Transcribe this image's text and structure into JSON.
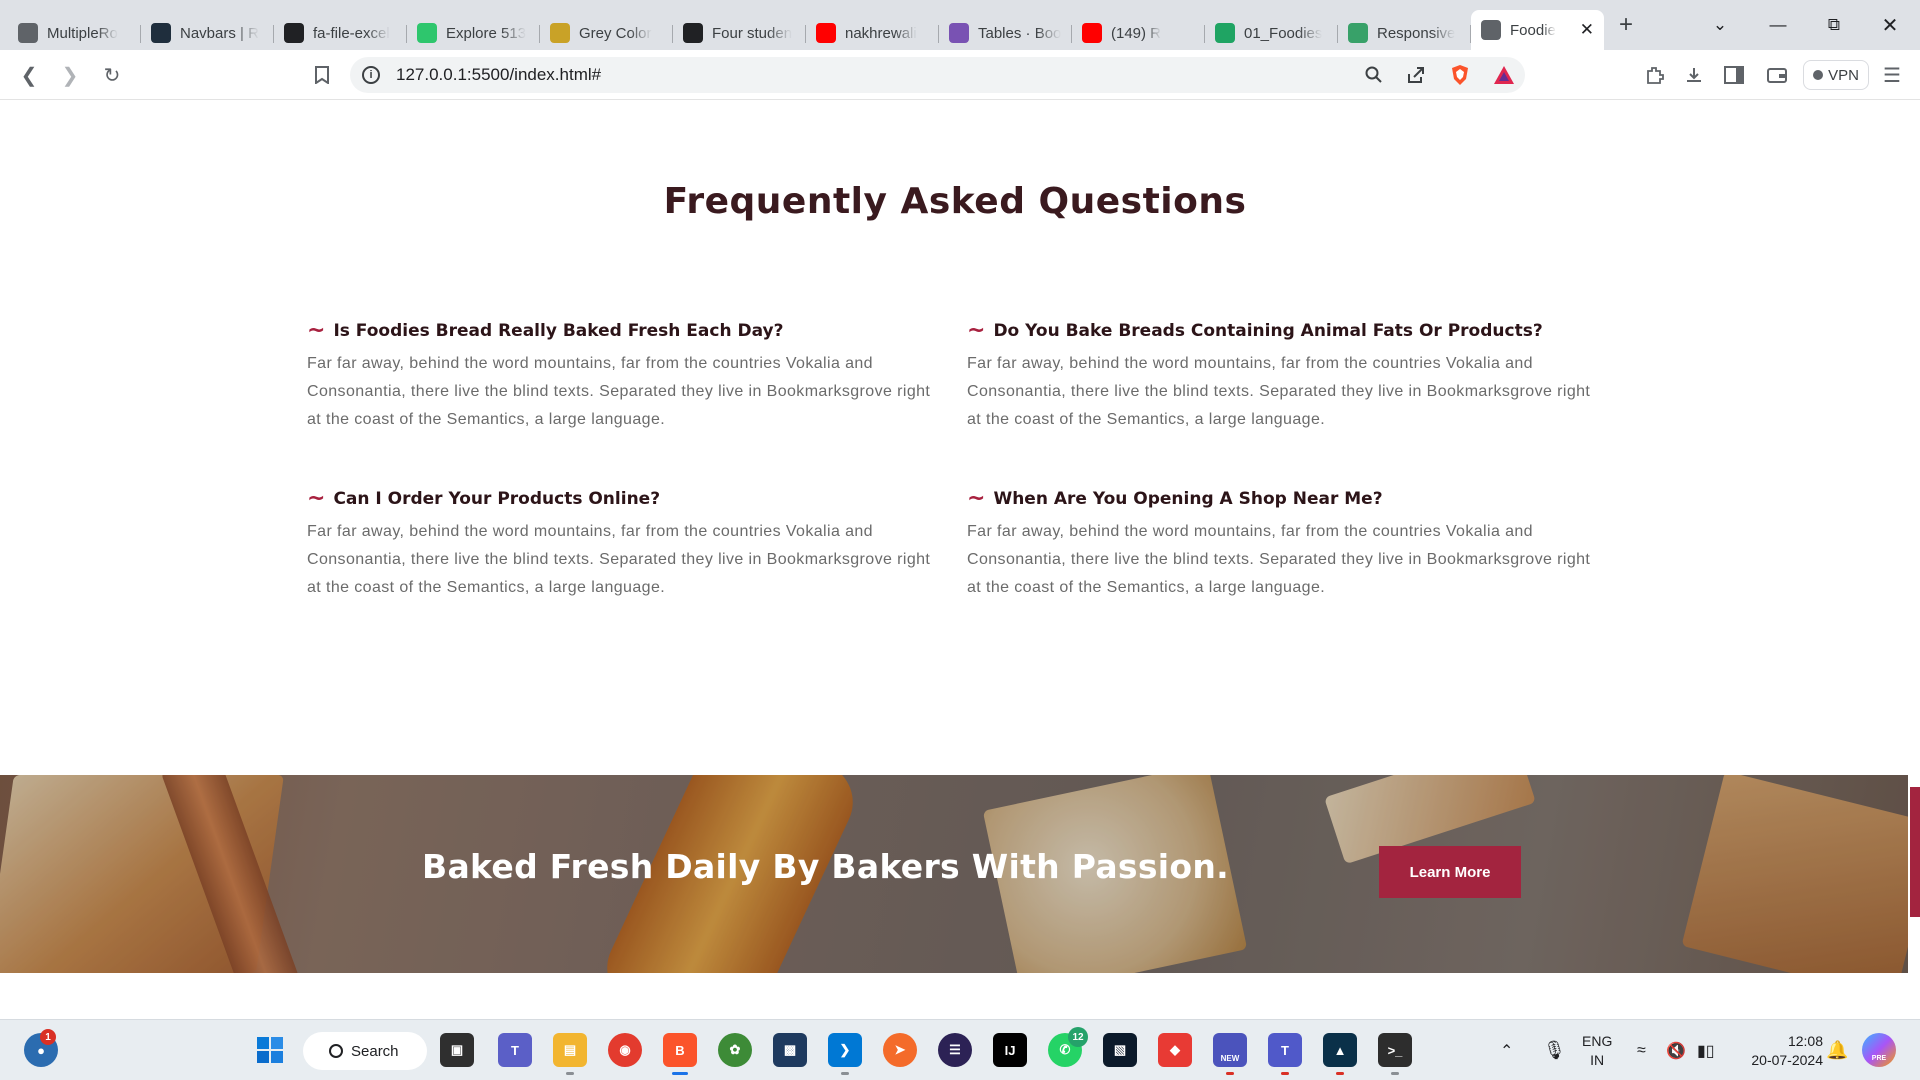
{
  "browser": {
    "tabs": [
      {
        "label": "MultipleRo",
        "icon": "globe-icon",
        "color": "#5f6368"
      },
      {
        "label": "Navbars | R",
        "icon": "react-bootstrap-icon",
        "color": "#1f2e3d"
      },
      {
        "label": "fa-file-excel",
        "icon": "font-awesome-flag-icon",
        "color": "#202124"
      },
      {
        "label": "Explore 513",
        "icon": "pixabay-icon",
        "color": "#2ec66d"
      },
      {
        "label": "Grey Color",
        "icon": "shield-icon",
        "color": "#c9a227"
      },
      {
        "label": "Four studen",
        "icon": "dev-icon",
        "color": "#202124"
      },
      {
        "label": "nakhrewali",
        "icon": "youtube-icon",
        "color": "#ff0000"
      },
      {
        "label": "Tables · Boo",
        "icon": "bootstrap-icon",
        "color": "#7952b3"
      },
      {
        "label": "(149) R",
        "icon": "youtube-muted-icon",
        "color": "#ff0000"
      },
      {
        "label": "01_Foodies",
        "icon": "google-drive-icon",
        "color": "#1fa463"
      },
      {
        "label": "Responsive",
        "icon": "codepen-leaf-icon",
        "color": "#38a169"
      },
      {
        "label": "Foodie",
        "icon": "globe-icon",
        "color": "#5f6368",
        "active": true
      }
    ],
    "url": "127.0.0.1:5500/index.html#",
    "vpn_label": "VPN"
  },
  "faq": {
    "title": "Frequently Asked Questions",
    "items": [
      {
        "question": "Is Foodies Bread Really Baked Fresh Each Day?",
        "answer": "Far far away, behind the word mountains, far from the countries Vokalia and Consonantia, there live the blind texts. Separated they live in Bookmarksgrove right at the coast of the Semantics, a large language."
      },
      {
        "question": "Do You Bake Breads Containing Animal Fats Or Products?",
        "answer": "Far far away, behind the word mountains, far from the countries Vokalia and Consonantia, there live the blind texts. Separated they live in Bookmarksgrove right at the coast of the Semantics, a large language."
      },
      {
        "question": "Can I Order Your Products Online?",
        "answer": "Far far away, behind the word mountains, far from the countries Vokalia and Consonantia, there live the blind texts. Separated they live in Bookmarksgrove right at the coast of the Semantics, a large language."
      },
      {
        "question": "When Are You Opening A Shop Near Me?",
        "answer": "Far far away, behind the word mountains, far from the countries Vokalia and Consonantia, there live the blind texts. Separated they live in Bookmarksgrove right at the coast of the Semantics, a large language."
      }
    ],
    "bullet": "~"
  },
  "banner": {
    "headline": "Baked Fresh Daily By Bakers With Passion.",
    "button_label": "Learn More",
    "accent_color": "#a3243f"
  },
  "taskbar": {
    "search_label": "Search",
    "notification_count": "1",
    "whatsapp_count": "12",
    "lang_line1": "ENG",
    "lang_line2": "IN",
    "time": "12:08",
    "date": "20-07-2024",
    "new_label": "NEW",
    "pre_label": "PRE"
  }
}
